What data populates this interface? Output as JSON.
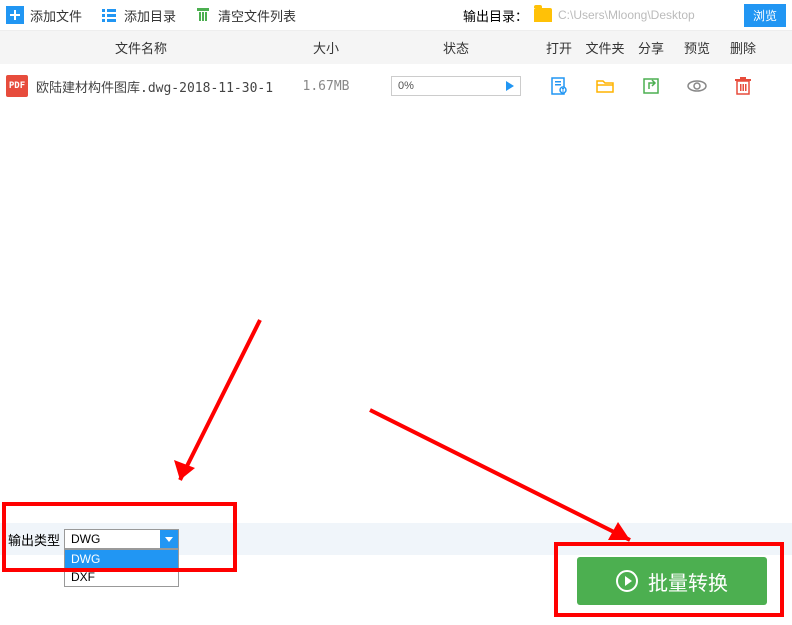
{
  "toolbar": {
    "add_file": "添加文件",
    "add_dir": "添加目录",
    "clear_list": "清空文件列表",
    "output_dir_label": "输出目录：",
    "output_path": "C:\\Users\\Mloong\\Desktop",
    "browse": "浏览"
  },
  "headers": {
    "name": "文件名称",
    "size": "大小",
    "status": "状态",
    "open": "打开",
    "folder": "文件夹",
    "share": "分享",
    "preview": "预览",
    "delete": "删除"
  },
  "rows": [
    {
      "badge": "PDF",
      "name": "欧陆建材构件图库.dwg-2018-11-30-1",
      "size": "1.67MB",
      "progress": "0%"
    }
  ],
  "output_type": {
    "label": "输出类型",
    "selected": "DWG",
    "options": [
      "DWG",
      "DXF"
    ]
  },
  "convert_button": "批量转换",
  "icon_colors": {
    "open": "#2196f3",
    "folder": "#ffb300",
    "share": "#4caf50",
    "preview": "#888",
    "delete": "#e74c3c"
  }
}
